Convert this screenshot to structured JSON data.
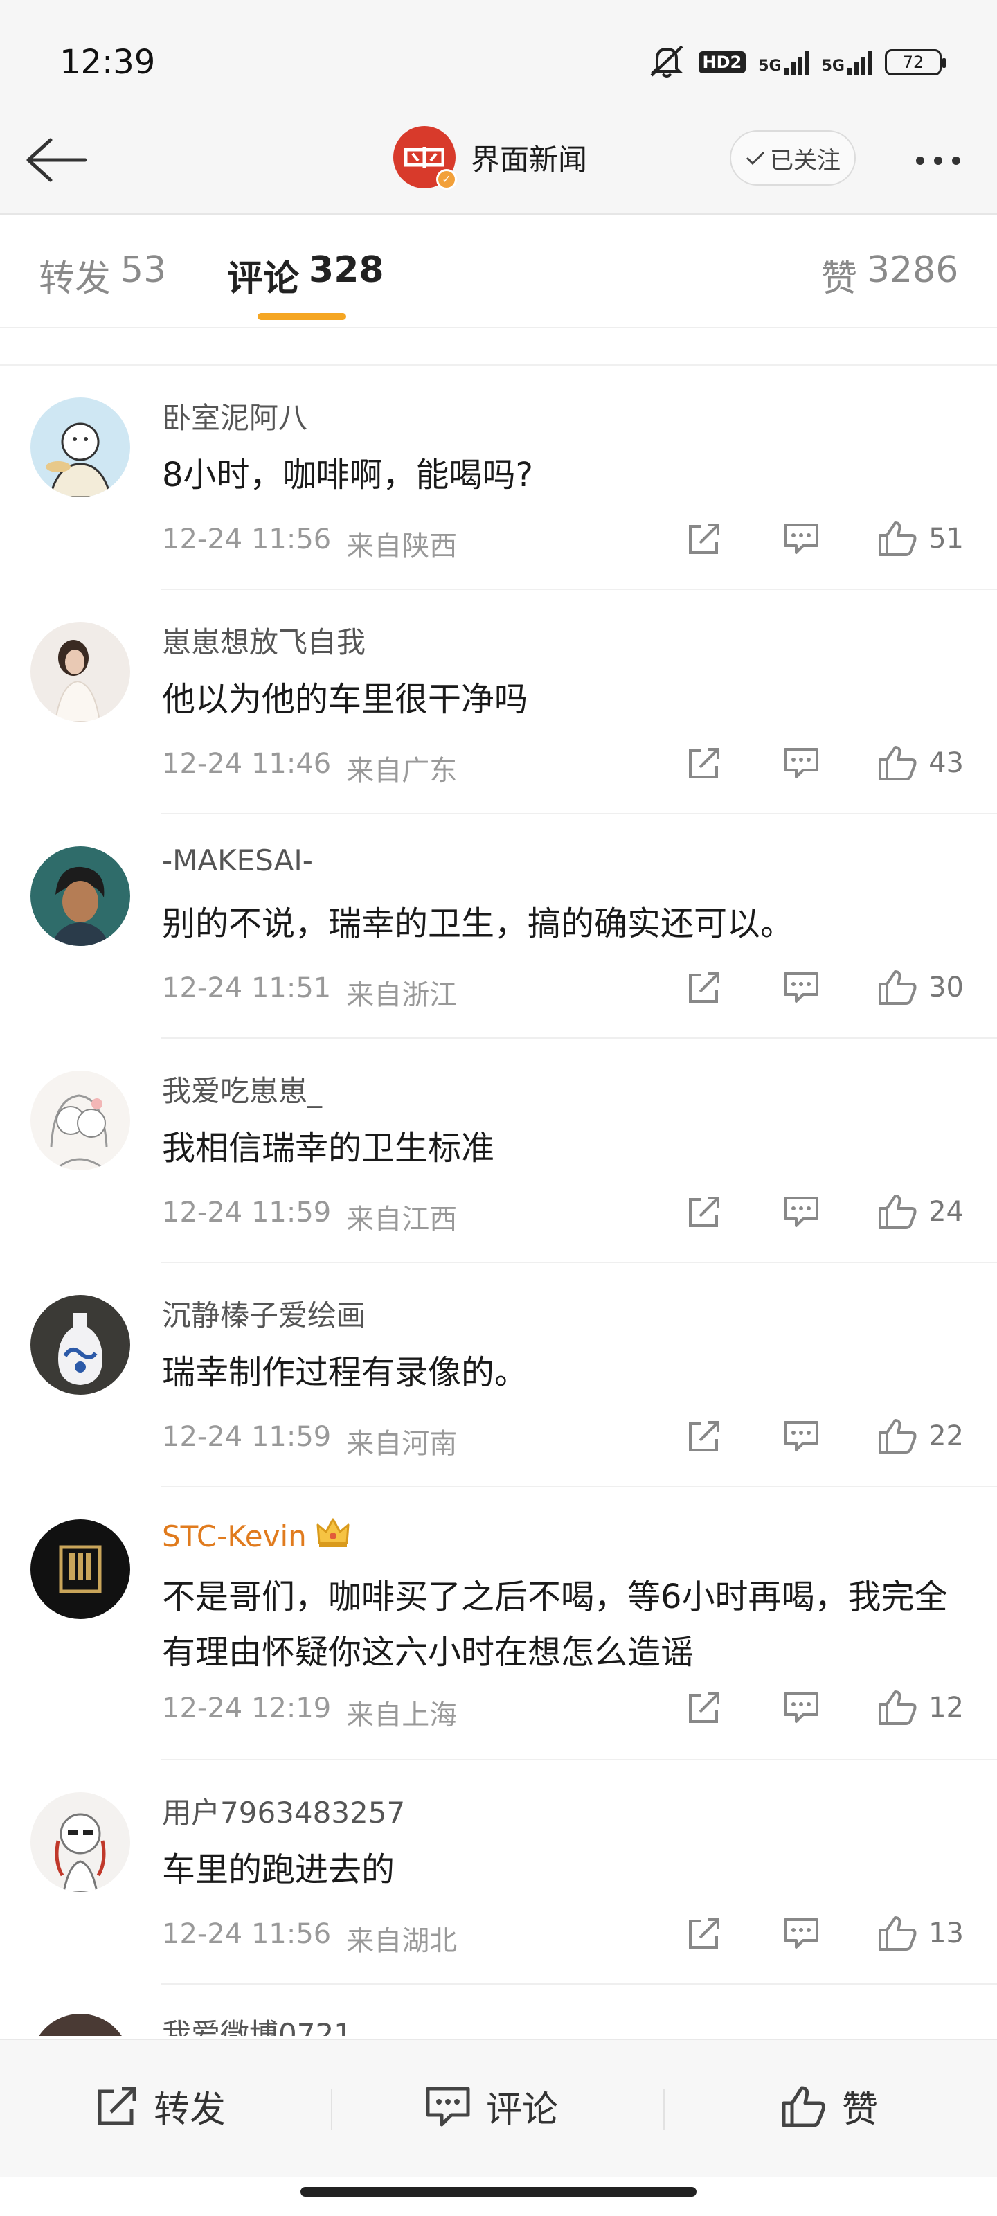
{
  "status_bar": {
    "time": "12:39",
    "hd": "HD2",
    "net1": "5G",
    "net2": "5G",
    "battery": "72",
    "icons": [
      "mute-icon",
      "hd-icon",
      "signal-icon",
      "battery-icon"
    ]
  },
  "nav": {
    "back_icon": "arrow-left-icon",
    "account_name": "界面新闻",
    "follow_label": "已关注",
    "more_icon": "ellipsis-icon"
  },
  "tabs": {
    "repost": {
      "label": "转发",
      "count": "53"
    },
    "comments": {
      "label": "评论",
      "count": "328"
    },
    "likes": {
      "label": "赞",
      "count": "3286"
    }
  },
  "comments": [
    {
      "user": "卧室泥阿八",
      "text": "8小时，咖啡啊，能喝吗?",
      "time": "12-24 11:56",
      "location": "来自陕西",
      "likes": "51"
    },
    {
      "user": "崽崽想放飞自我",
      "text": "他以为他的车里很干净吗",
      "time": "12-24 11:46",
      "location": "来自广东",
      "likes": "43"
    },
    {
      "user": "-MAKESAI-",
      "text": "别的不说，瑞幸的卫生，搞的确实还可以。",
      "time": "12-24 11:51",
      "location": "来自浙江",
      "likes": "30"
    },
    {
      "user": "我爱吃崽崽_",
      "text": "我相信瑞幸的卫生标准",
      "time": "12-24 11:59",
      "location": "来自江西",
      "likes": "24"
    },
    {
      "user": "沉静榛子爱绘画",
      "text": "瑞幸制作过程有录像的。",
      "time": "12-24 11:59",
      "location": "来自河南",
      "likes": "22"
    },
    {
      "user": "STC-Kevin",
      "text": "不是哥们，咖啡买了之后不喝，等6小时再喝，我完全有理由怀疑你这六小时在想怎么造谣",
      "time": "12-24 12:19",
      "location": "来自上海",
      "likes": "12"
    },
    {
      "user": "用户7963483257",
      "text": "车里的跑进去的",
      "time": "12-24 11:56",
      "location": "来自湖北",
      "likes": "13"
    }
  ],
  "partial_comment": {
    "user": "我爱微博0721"
  },
  "bottom_bar": {
    "repost_label": "转发",
    "comment_label": "评论",
    "like_label": "赞"
  },
  "colors": {
    "accent": "#f5a623",
    "vip_name": "#e07b1e",
    "brand_red": "#d83a2b"
  }
}
